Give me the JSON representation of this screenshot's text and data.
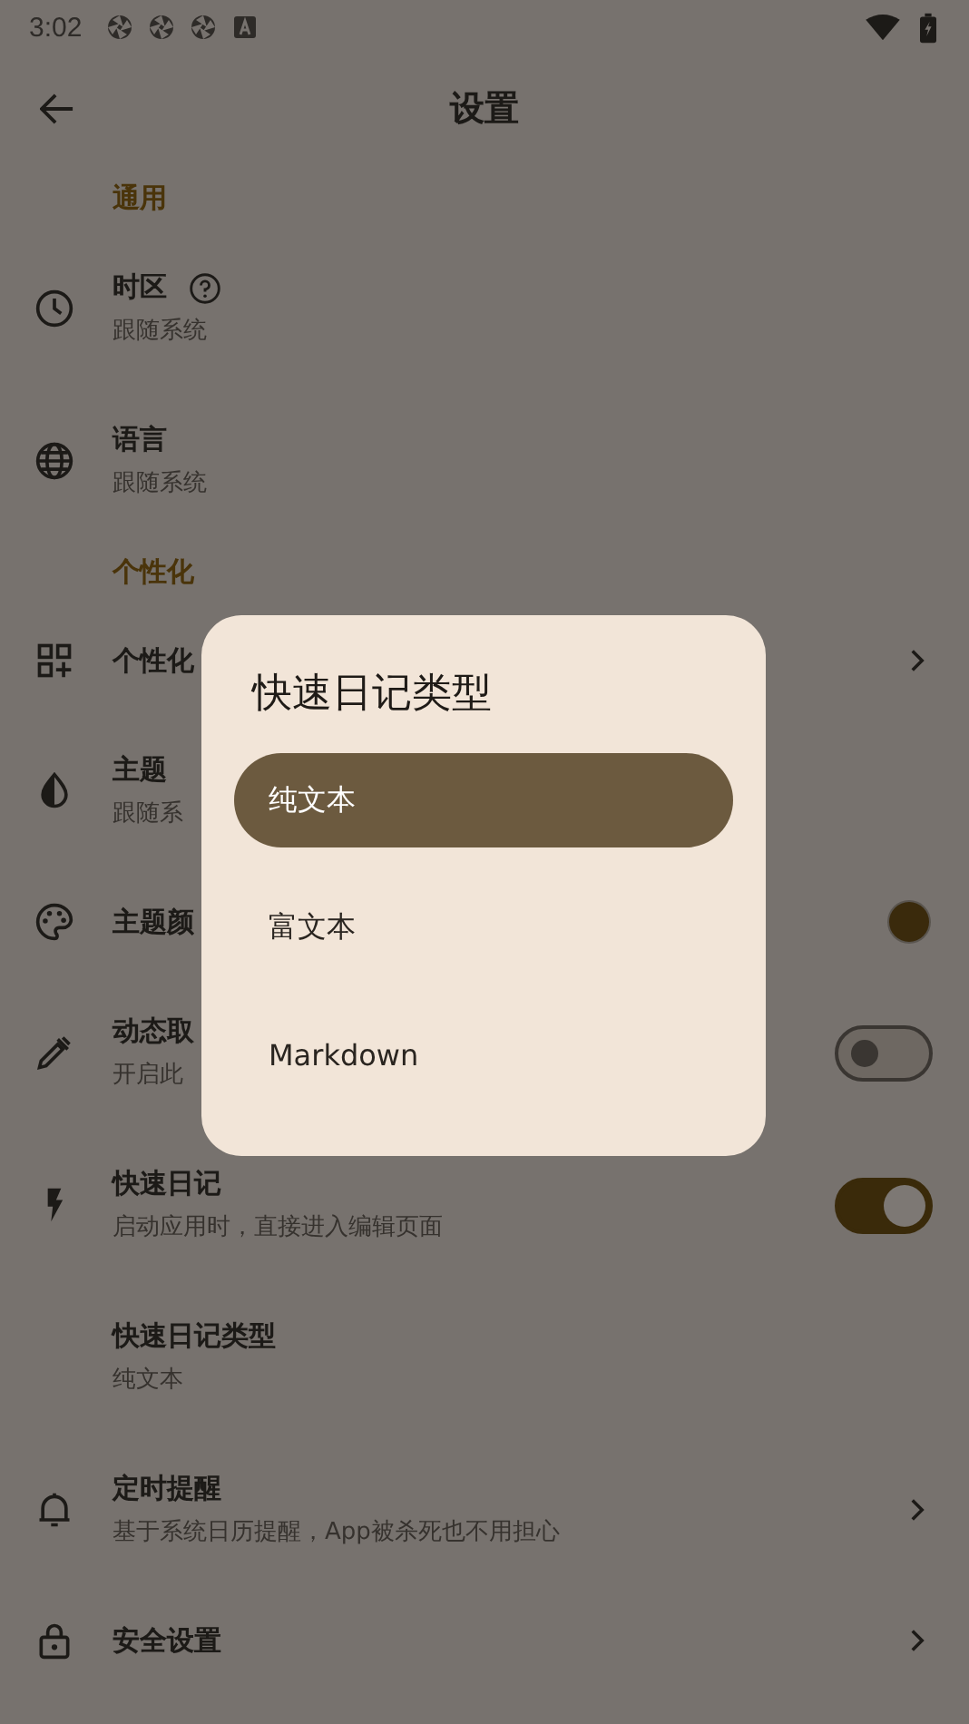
{
  "status_bar": {
    "time": "3:02"
  },
  "app_bar": {
    "title": "设置"
  },
  "sections": [
    {
      "title": "通用",
      "items": [
        {
          "title": "时区",
          "subtitle": "跟随系统",
          "kind": "plain"
        },
        {
          "title": "语言",
          "subtitle": "跟随系统",
          "kind": "plain"
        }
      ]
    },
    {
      "title": "个性化",
      "items": [
        {
          "title": "个性化",
          "kind": "chevron"
        },
        {
          "title": "主题",
          "subtitle": "跟随系",
          "kind": "plain"
        },
        {
          "title": "主题颜",
          "kind": "color",
          "color": "#3a2a0c"
        },
        {
          "title": "动态取",
          "subtitle": "开启此",
          "kind": "switch",
          "on": false
        },
        {
          "title": "快速日记",
          "subtitle": "启动应用时，直接进入编辑页面",
          "kind": "switch",
          "on": true
        },
        {
          "title": "快速日记类型",
          "subtitle": "纯文本",
          "kind": "plain"
        },
        {
          "title": "定时提醒",
          "subtitle": "基于系统日历提醒，App被杀死也不用担心",
          "kind": "chevron"
        },
        {
          "title": "安全设置",
          "kind": "chevron"
        }
      ]
    }
  ],
  "dialog": {
    "title": "快速日记类型",
    "options": [
      {
        "label": "纯文本",
        "selected": true
      },
      {
        "label": "富文本",
        "selected": false
      },
      {
        "label": "Markdown",
        "selected": false
      }
    ]
  }
}
